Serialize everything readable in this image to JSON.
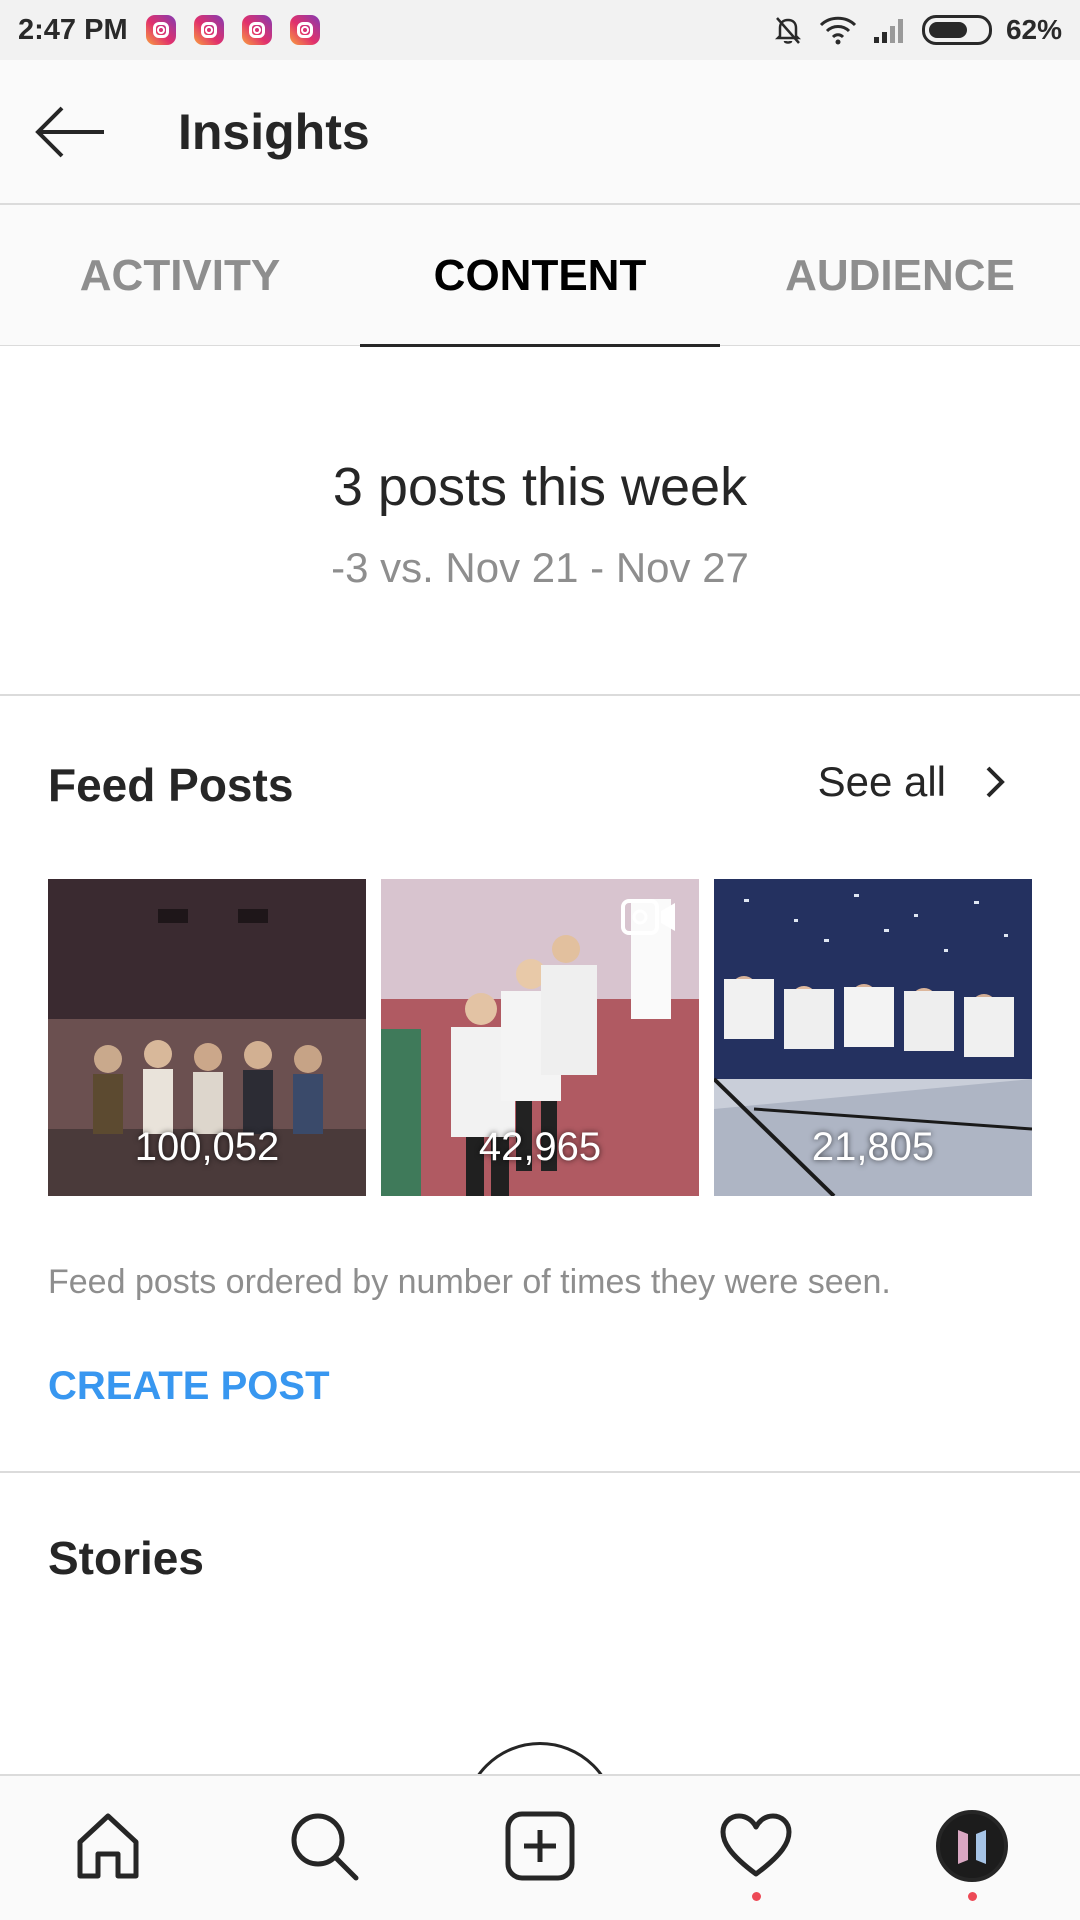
{
  "status_bar": {
    "time": "2:47 PM",
    "notification_icons": [
      "instagram-icon",
      "instagram-icon",
      "instagram-icon",
      "instagram-icon"
    ],
    "battery_percent": "62%",
    "battery_level": 0.62
  },
  "header": {
    "title": "Insights"
  },
  "tabs": [
    {
      "label": "ACTIVITY",
      "active": false
    },
    {
      "label": "CONTENT",
      "active": true
    },
    {
      "label": "AUDIENCE",
      "active": false
    }
  ],
  "summary": {
    "headline": "3 posts this week",
    "comparison": "-3 vs. Nov 21 - Nov 27"
  },
  "feed_posts": {
    "title": "Feed Posts",
    "see_all": "See all",
    "posts": [
      {
        "count": "100,052",
        "is_video": false
      },
      {
        "count": "42,965",
        "is_video": true
      },
      {
        "count": "21,805",
        "is_video": false
      }
    ],
    "note": "Feed posts ordered by number of times they were seen.",
    "create_post": "CREATE POST"
  },
  "stories": {
    "title": "Stories"
  },
  "bottom_nav": {
    "items": [
      "home-icon",
      "search-icon",
      "add-post-icon",
      "activity-heart-icon",
      "profile-avatar"
    ],
    "accent_color": "#3897f0",
    "badge_color": "#ed4956"
  }
}
